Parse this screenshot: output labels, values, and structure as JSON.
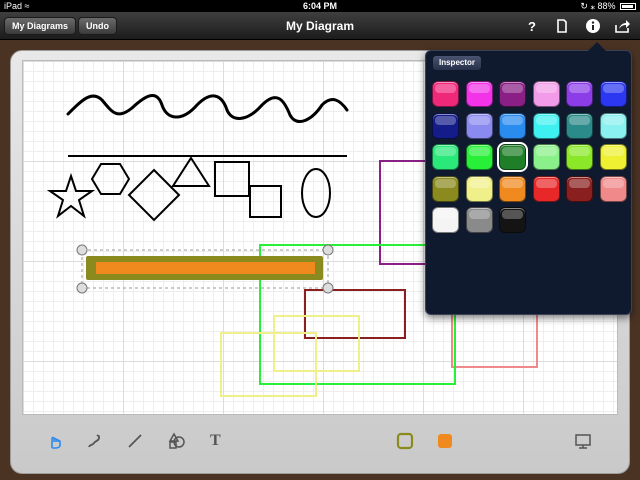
{
  "statusbar": {
    "device": "iPad",
    "time": "6:04 PM",
    "battery": "88%"
  },
  "toolbar": {
    "diagrams_label": "My Diagrams",
    "undo_label": "Undo",
    "title": "My Diagram",
    "icons": [
      "help-icon",
      "page-icon",
      "info-icon",
      "share-icon"
    ]
  },
  "inspector": {
    "title": "Inspector",
    "selected_index": 14,
    "colors": [
      "#f0287a",
      "#f233e8",
      "#8a1f85",
      "#f29be8",
      "#8d3de8",
      "#2b37f0",
      "#141c8a",
      "#8a8af0",
      "#2b8cf0",
      "#3ff0f0",
      "#2b8a8a",
      "#8af0f0",
      "#2be87a",
      "#28f038",
      "#1f7f28",
      "#8af08a",
      "#8ae828",
      "#f0f033",
      "#8a8a1f",
      "#f0f08a",
      "#f08a1f",
      "#e82828",
      "#8a1f1f",
      "#f08a8a",
      "#f4f4f4",
      "#8a8a8a",
      "#141414"
    ]
  },
  "bottombar": {
    "tools": [
      "hand-icon",
      "freehand-icon",
      "line-icon",
      "shapes-icon",
      "text-icon"
    ],
    "text_tool_label": "T",
    "stroke_color": "#8a8a1f",
    "fill_color": "#f08a1f",
    "right_tool": "presentation-icon"
  }
}
